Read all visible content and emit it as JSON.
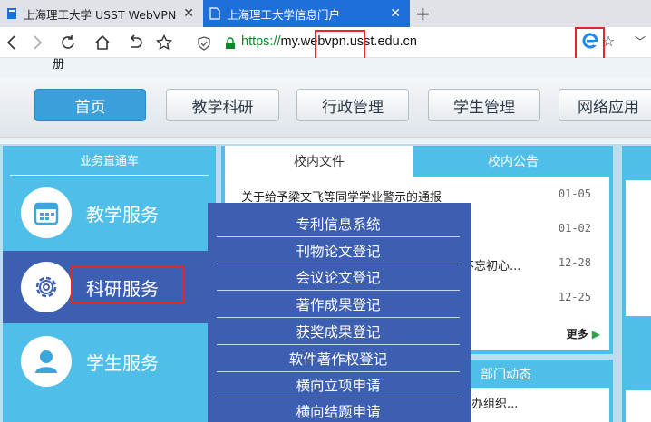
{
  "browser": {
    "tabs": [
      {
        "title": "上海理工大学 USST WebVPN",
        "active": false
      },
      {
        "title": "上海理工大学信息门户",
        "active": true
      }
    ],
    "new_tab": "+",
    "url_scheme": "https://",
    "url_host": "my.webvpn.usst.edu.cn"
  },
  "page": {
    "cutoff_text": "册",
    "menu": [
      "首页",
      "教学科研",
      "行政管理",
      "学生管理",
      "网络应用"
    ],
    "sidebar": {
      "header": "业务直通车",
      "items": [
        {
          "label": "教学服务",
          "icon": "calendar-icon"
        },
        {
          "label": "科研服务",
          "icon": "gear-icon"
        },
        {
          "label": "学生服务",
          "icon": "user-icon"
        }
      ]
    },
    "news": {
      "tabs": [
        "校内文件",
        "校内公告"
      ],
      "rows": [
        {
          "title": "关于给予梁文飞等同学学业警示的通报",
          "date": "01-05"
        },
        {
          "title": "",
          "date": "01-02"
        },
        {
          "title": "不忘初心...",
          "date": "12-28"
        },
        {
          "title": "",
          "date": "12-25"
        }
      ],
      "more": "更多"
    },
    "dept": {
      "header": "部门动态",
      "row": "办组织..."
    },
    "dropdown": [
      "专利信息系统",
      "刊物论文登记",
      "会议论文登记",
      "著作成果登记",
      "获奖成果登记",
      "软件著作权登记",
      "横向立项申请",
      "横向结题申请"
    ]
  },
  "colors": {
    "tab_active": "#1e6fd9",
    "menu_active": "#3b9fdc",
    "sidebar": "#4fbfe9",
    "dropdown": "#3c5fb1",
    "highlight_red": "#e02a2a"
  }
}
